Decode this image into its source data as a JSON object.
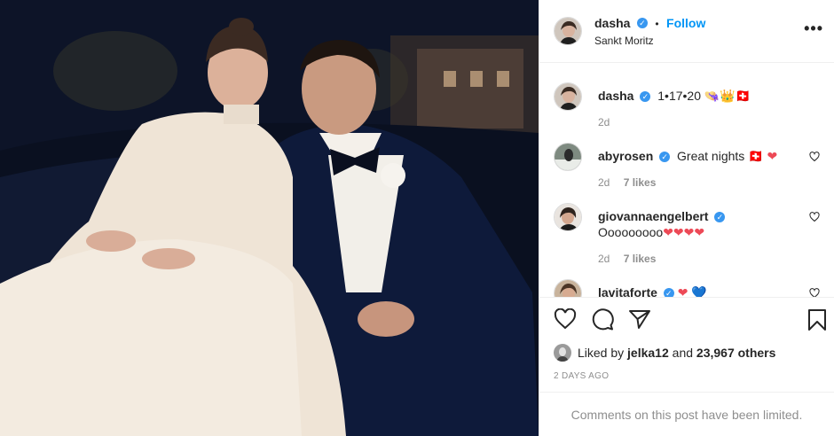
{
  "post": {
    "author": "dasha",
    "follow_label": "Follow",
    "separator": "•",
    "location": "Sankt Moritz",
    "more_label": "•••",
    "verified_mark": "✓"
  },
  "caption": {
    "username": "dasha",
    "text": "1•17•20 👒👑🇨🇭",
    "time": "2d"
  },
  "comments": [
    {
      "username": "abyrosen",
      "verified": true,
      "text": "Great nights 🇨🇭",
      "emoji": "❤",
      "time": "2d",
      "likes": "7 likes"
    },
    {
      "username": "giovannaengelbert",
      "verified": true,
      "text": "Ooooooooo",
      "emoji": "❤❤❤❤",
      "time": "2d",
      "likes": "7 likes"
    },
    {
      "username": "lavitaforte",
      "verified": true,
      "text": "",
      "emoji_red": "❤",
      "emoji_blue": "💙"
    }
  ],
  "likes": {
    "prefix": "Liked by",
    "user": "jelka12",
    "joiner": "and",
    "others": "23,967 others"
  },
  "posted_ago": "2 DAYS AGO",
  "comments_limited": "Comments on this post have been limited.",
  "icons": [
    "heart-icon",
    "comment-icon",
    "share-icon",
    "bookmark-icon",
    "more-icon",
    "verified-icon"
  ],
  "colors": {
    "link": "#0095f6",
    "verified": "#3897f0",
    "heart": "#ed4956",
    "muted": "#8e8e8e",
    "border": "#efefef"
  }
}
